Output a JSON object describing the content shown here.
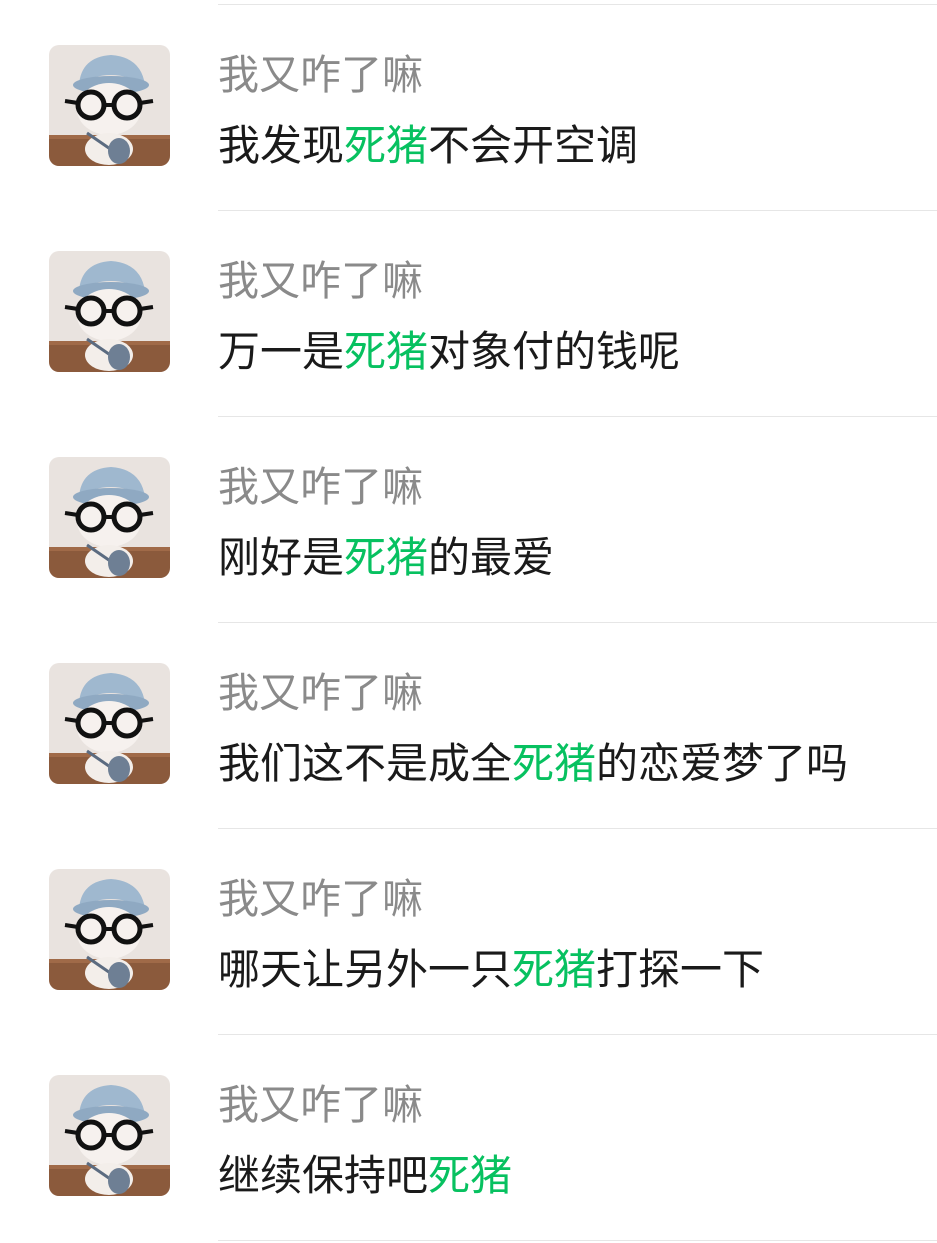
{
  "highlight_color": "#07c160",
  "results": [
    {
      "sender": "我又咋了嘛",
      "parts": [
        {
          "text": "我发现"
        },
        {
          "text": "死猪",
          "highlight": true
        },
        {
          "text": "不会开空调"
        }
      ]
    },
    {
      "sender": "我又咋了嘛",
      "parts": [
        {
          "text": "万一是"
        },
        {
          "text": "死猪",
          "highlight": true
        },
        {
          "text": "对象付的钱呢"
        }
      ]
    },
    {
      "sender": "我又咋了嘛",
      "parts": [
        {
          "text": "刚好是"
        },
        {
          "text": "死猪",
          "highlight": true
        },
        {
          "text": "的最爱"
        }
      ]
    },
    {
      "sender": "我又咋了嘛",
      "parts": [
        {
          "text": "我们这不是成全"
        },
        {
          "text": "死猪",
          "highlight": true
        },
        {
          "text": "的恋爱梦了吗"
        }
      ]
    },
    {
      "sender": "我又咋了嘛",
      "parts": [
        {
          "text": "哪天让另外一只"
        },
        {
          "text": "死猪",
          "highlight": true
        },
        {
          "text": "打探一下"
        }
      ]
    },
    {
      "sender": "我又咋了嘛",
      "parts": [
        {
          "text": "继续保持吧"
        },
        {
          "text": "死猪",
          "highlight": true
        }
      ]
    }
  ],
  "avatar_icon": "plush-doll-with-glasses-avatar"
}
